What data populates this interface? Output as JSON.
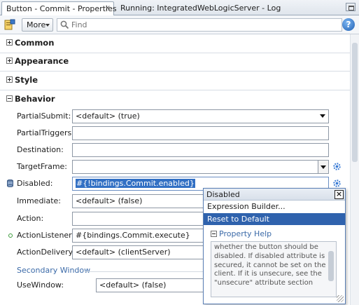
{
  "tabs": [
    {
      "label": "Button - Commit - Properties",
      "close": "×",
      "active": true
    },
    {
      "label": "Running: IntegratedWebLogicServer - Log",
      "active": false
    }
  ],
  "toolbar": {
    "more_label": "More",
    "search_placeholder": "Find",
    "help_label": "?"
  },
  "sections": {
    "common": "Common",
    "appearance": "Appearance",
    "style": "Style",
    "behavior": "Behavior"
  },
  "behavior": {
    "partial_submit": {
      "label": "PartialSubmit:",
      "value": "<default> (true)"
    },
    "partial_triggers": {
      "label": "PartialTriggers:",
      "value": ""
    },
    "destination": {
      "label": "Destination:",
      "value": ""
    },
    "target_frame": {
      "label": "TargetFrame:",
      "value": ""
    },
    "disabled": {
      "label": "Disabled:",
      "value": "#{!bindings.Commit.enabled}"
    },
    "immediate": {
      "label": "Immediate:",
      "value": "<default> (false)"
    },
    "action": {
      "label": "Action:",
      "value": ""
    },
    "action_listener": {
      "label": "ActionListener:",
      "value": "#{bindings.Commit.execute}"
    },
    "action_delivery": {
      "label": "ActionDelivery:",
      "value": "<default> (clientServer)"
    },
    "secondary_window": "Secondary Window",
    "use_window": {
      "label": "UseWindow:",
      "value": "<default> (false)"
    }
  },
  "popup": {
    "title": "Disabled",
    "close": "×",
    "items": [
      "Expression Builder...",
      "Reset to Default"
    ],
    "property_help_label": "Property Help",
    "help_text": "whether the button should be disabled. If disabled attribute is secured, it cannot be set on the client. If it is unsecure, see the \"unsecure\" attribute section"
  },
  "colors": {
    "accent": "#2f62ad",
    "link": "#3b6aa8",
    "selection": "#3270c4"
  },
  "icons": [
    "properties-icon",
    "search-icon",
    "help-icon",
    "gear-icon",
    "database-icon",
    "listener-icon",
    "close-icon",
    "chevron-down-icon",
    "window-restore-icon"
  ]
}
